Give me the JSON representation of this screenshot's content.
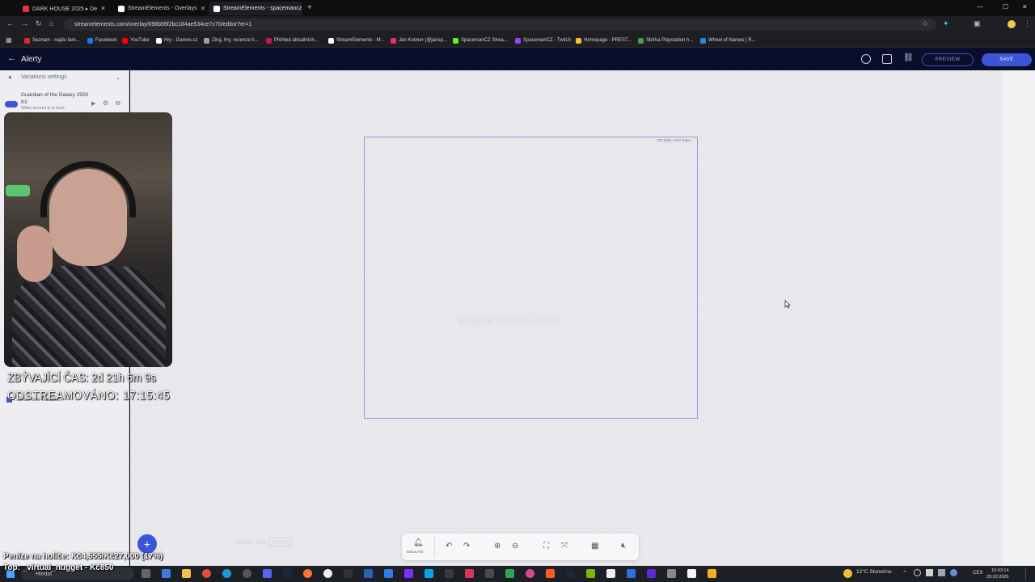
{
  "browser": {
    "tabs": [
      {
        "label": "DARK HOUSE 2025 ▸ De",
        "color": "#e53935"
      },
      {
        "label": "StreamElements - Overlays",
        "color": "#ffffff"
      },
      {
        "label": "StreamElements - spacemancz",
        "color": "#ffffff"
      }
    ],
    "new_tab": "+",
    "url": "streamelements.com/overlay/698b55f2bc184ae534ce7c70/editor?er=1",
    "bookmarks": [
      {
        "label": "Seznam - najdu tam...",
        "color": "#d32f2f"
      },
      {
        "label": "Facebook",
        "color": "#1877f2"
      },
      {
        "label": "YouTube",
        "color": "#ff0000"
      },
      {
        "label": "Hry - Games.cz",
        "color": "#ffffff"
      },
      {
        "label": "Zing, hry, recenze h...",
        "color": "#9e9e9e"
      },
      {
        "label": "Přehled aktuálních...",
        "color": "#c2185b"
      },
      {
        "label": "StreamElements - M...",
        "color": "#ffffff"
      },
      {
        "label": "Jan Kotmer (@jansp...",
        "color": "#e1306c"
      },
      {
        "label": "SpacemanCZ Strea...",
        "color": "#53fc18"
      },
      {
        "label": "SpacemanCZ - Twitch",
        "color": "#9146ff"
      },
      {
        "label": "Homepage - PREST...",
        "color": "#fbc02d"
      },
      {
        "label": "Sbírka Playstation h...",
        "color": "#43a047"
      },
      {
        "label": "Wheel of Names | R...",
        "color": "#1e88e5"
      }
    ]
  },
  "app": {
    "title": "Alerty",
    "preview_label": "PREVIEW",
    "save_label": "SAVE",
    "accent": "#3c55d6"
  },
  "left_panel": {
    "section_title": "Variations settings",
    "variation_name": "Guardian of the Galaxy 2500 Kč",
    "variation_desc": "When amount is at least",
    "option_label": "...than one matches",
    "add_button": "+"
  },
  "canvas": {
    "widget_size": "723.20px x 617.84px",
    "ghost_title": "Větkus",
    "ghost_sub": "věnoval 2500",
    "delete_hint": "Delete with",
    "delete_key": "delete"
  },
  "toolbar": {
    "emulate_label": "EMULATE"
  },
  "stream_overlay": {
    "remaining": "ZBÝVAJÍCÍ ČAS: 2d 21h 6m 9s",
    "streamed": "ODSTREAMOVÁNO: 17:15:45",
    "money": "Peníze na holiče: Kč4,555/Kč27,000 (17%)",
    "top": "Top: _virtual_nugget - Kč850"
  },
  "taskbar": {
    "search_placeholder": "Hledat",
    "weather": "12°C Slunečno",
    "lang": "CES",
    "time": "10:43:14",
    "date": "28.02.2026"
  }
}
